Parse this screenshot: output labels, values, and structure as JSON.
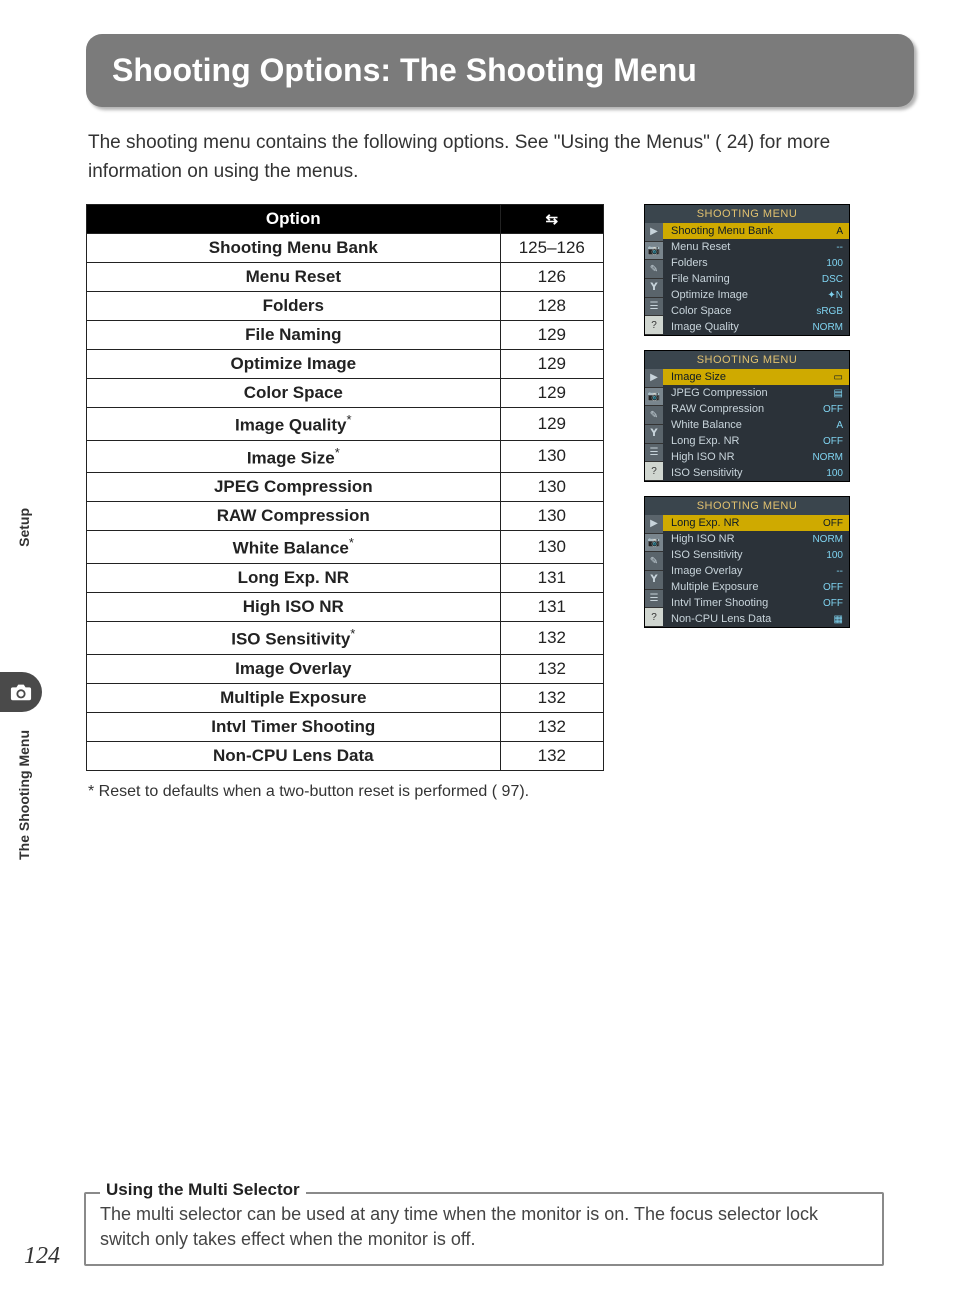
{
  "banner_title": "Shooting Options: The Shooting Menu",
  "intro": "The shooting menu contains the following options.  See \"Using the Menus\" (      24) for more information on using the menus.",
  "table": {
    "headers": [
      "Option",
      "⇆"
    ],
    "rows": [
      {
        "opt": "Shooting Menu Bank",
        "page": "125–126",
        "ast": false
      },
      {
        "opt": "Menu Reset",
        "page": "126",
        "ast": false
      },
      {
        "opt": "Folders",
        "page": "128",
        "ast": false
      },
      {
        "opt": "File Naming",
        "page": "129",
        "ast": false
      },
      {
        "opt": "Optimize Image",
        "page": "129",
        "ast": false
      },
      {
        "opt": "Color Space",
        "page": "129",
        "ast": false
      },
      {
        "opt": "Image Quality",
        "page": "129",
        "ast": true
      },
      {
        "opt": "Image Size",
        "page": "130",
        "ast": true
      },
      {
        "opt": "JPEG Compression",
        "page": "130",
        "ast": false
      },
      {
        "opt": "RAW Compression",
        "page": "130",
        "ast": false
      },
      {
        "opt": "White Balance",
        "page": "130",
        "ast": true
      },
      {
        "opt": "Long Exp. NR",
        "page": "131",
        "ast": false
      },
      {
        "opt": "High ISO NR",
        "page": "131",
        "ast": false
      },
      {
        "opt": "ISO Sensitivity",
        "page": "132",
        "ast": true
      },
      {
        "opt": "Image Overlay",
        "page": "132",
        "ast": false
      },
      {
        "opt": "Multiple Exposure",
        "page": "132",
        "ast": false
      },
      {
        "opt": "Intvl Timer Shooting",
        "page": "132",
        "ast": false
      },
      {
        "opt": "Non-CPU Lens Data",
        "page": "132",
        "ast": false
      }
    ]
  },
  "footnote": "* Reset to defaults when a two-button reset is performed (     97).",
  "screens": [
    {
      "title": "SHOOTING MENU",
      "rows": [
        {
          "label": "Shooting Menu Bank",
          "val": "A",
          "sel": true
        },
        {
          "label": "Menu Reset",
          "val": "--"
        },
        {
          "label": "Folders",
          "val": "100"
        },
        {
          "label": "File Naming",
          "val": "DSC"
        },
        {
          "label": "Optimize Image",
          "val": "✦N"
        },
        {
          "label": "Color Space",
          "val": "sRGB"
        },
        {
          "label": "Image Quality",
          "val": "NORM"
        }
      ]
    },
    {
      "title": "SHOOTING MENU",
      "rows": [
        {
          "label": "Image Size",
          "val": "▭",
          "sel": true
        },
        {
          "label": "JPEG Compression",
          "val": "▤"
        },
        {
          "label": "RAW Compression",
          "val": "OFF"
        },
        {
          "label": "White Balance",
          "val": "A"
        },
        {
          "label": "Long Exp. NR",
          "val": "OFF"
        },
        {
          "label": "High ISO NR",
          "val": "NORM"
        },
        {
          "label": "ISO Sensitivity",
          "val": "100"
        }
      ]
    },
    {
      "title": "SHOOTING MENU",
      "rows": [
        {
          "label": "Long Exp. NR",
          "val": "OFF",
          "sel": true
        },
        {
          "label": "High ISO NR",
          "val": "NORM"
        },
        {
          "label": "ISO Sensitivity",
          "val": "100"
        },
        {
          "label": "Image Overlay",
          "val": "--"
        },
        {
          "label": "Multiple Exposure",
          "val": "OFF"
        },
        {
          "label": "Intvl Timer Shooting",
          "val": "OFF"
        },
        {
          "label": "Non-CPU Lens Data",
          "val": "▦"
        }
      ]
    }
  ],
  "tip": {
    "title": "Using the Multi Selector",
    "text": "The multi selector can be used at any time when the monitor is on.  The focus selector lock switch only takes effect when the monitor is off."
  },
  "side": {
    "tab1": "Setup",
    "tab2": "The Shooting Menu"
  },
  "pagenum": "124"
}
